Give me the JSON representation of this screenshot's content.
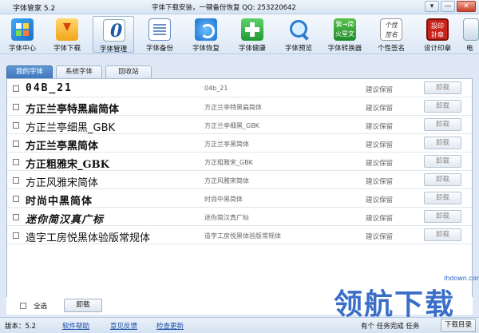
{
  "window": {
    "title": "字体管家 5.2",
    "slogan": "字体下载安装，一键备份恢复 QQ: 253220642",
    "controls": {
      "dropdown": "▾",
      "minimize": "—",
      "close": "✕"
    }
  },
  "toolbar": [
    {
      "id": "center",
      "label": "字体中心",
      "icon": "grid-icon"
    },
    {
      "id": "download",
      "label": "字体下载",
      "icon": "download-icon"
    },
    {
      "id": "manage",
      "label": "字体管理",
      "icon": "font-manage-icon",
      "active": true
    },
    {
      "id": "backup",
      "label": "字体备份",
      "icon": "document-icon"
    },
    {
      "id": "restore",
      "label": "字体恢复",
      "icon": "restore-icon"
    },
    {
      "id": "health",
      "label": "字体健康",
      "icon": "medical-kit-icon"
    },
    {
      "id": "preview",
      "label": "字体预览",
      "icon": "magnifier-icon"
    },
    {
      "id": "convert",
      "label": "字体转换器",
      "icon": "convert-icon",
      "glyph": "繁→简 火星文"
    },
    {
      "id": "sign",
      "label": "个性签名",
      "icon": "signature-icon",
      "glyph": "个性 签名"
    },
    {
      "id": "seal",
      "label": "设计印章",
      "icon": "seal-icon",
      "glyph": "設印 計章"
    },
    {
      "id": "more",
      "label": "电",
      "icon": "more-icon"
    }
  ],
  "tabs": [
    {
      "label": "我的字体",
      "active": true
    },
    {
      "label": "系统字体",
      "active": false
    },
    {
      "label": "回收站",
      "active": false
    }
  ],
  "fonts": [
    {
      "sample": "04B_21",
      "file": "04b_21",
      "status": "建议保留",
      "action": "卸载",
      "style": "pixel"
    },
    {
      "sample": "方正兰亭特黑扁简体",
      "file": "方正兰亭特黑扁简体",
      "status": "建议保留",
      "action": "卸载",
      "style": "black"
    },
    {
      "sample": "方正兰亭细黑_GBK",
      "file": "方正兰亭细黑_GBK",
      "status": "建议保留",
      "action": "卸载",
      "style": "thin"
    },
    {
      "sample": "方正兰亭黑简体",
      "file": "方正兰亭黑简体",
      "status": "建议保留",
      "action": "卸载",
      "style": "bold"
    },
    {
      "sample": "方正粗雅宋_GBK",
      "file": "方正粗雅宋_GBK",
      "status": "建议保留",
      "action": "卸载",
      "style": "serif"
    },
    {
      "sample": "方正风雅宋简体",
      "file": "方正风雅宋简体",
      "status": "建议保留",
      "action": "卸载",
      "style": "serif2"
    },
    {
      "sample": "时尚中黑简体",
      "file": "时尚中黑简体",
      "status": "建议保留",
      "action": "卸载",
      "style": "fashion"
    },
    {
      "sample": "迷你简汉真广标",
      "file": "迷你简汉真广标",
      "status": "建议保留",
      "action": "卸载",
      "style": "mini"
    },
    {
      "sample": "造字工房悦黑体验版常规体",
      "file": "造字工房悦黑体验版常规体",
      "status": "建议保留",
      "action": "卸载",
      "style": "pen"
    }
  ],
  "select_bar": {
    "select_all": "全选",
    "uninstall": "卸载"
  },
  "status_bar": {
    "version": "版本：5.2",
    "help": "软件帮助",
    "feedback": "意见反馈",
    "update": "检查更新",
    "tasks": "有个 任务完成 任务",
    "downloads": "下载目录"
  },
  "watermark": {
    "text": "领航下载",
    "url": "lhdown.com"
  }
}
